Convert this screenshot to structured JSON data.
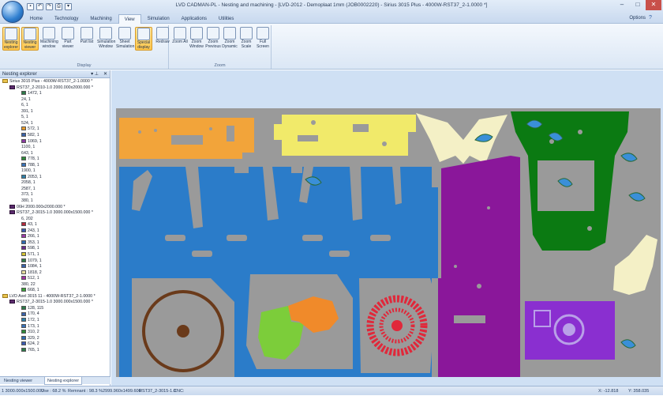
{
  "window": {
    "title": "LVD CADMAN-PL - Nesting and machining - [LVD-2012 - Demoplaat 1mm (JOB0002220) - Sirius 3015 Plus - 4000W-RST37_2-1.0000 *]",
    "qat_icons": [
      "save-icon",
      "undo-icon",
      "redo-icon",
      "print-icon",
      "customize-icon"
    ]
  },
  "ribbon": {
    "tabs": [
      "Home",
      "Technology",
      "Machining",
      "View",
      "Simulation",
      "Applications",
      "Utilities"
    ],
    "active_tab": "View",
    "options_label": "Options",
    "groups": [
      {
        "label": "Display",
        "buttons": [
          {
            "label": "Nesting explorer",
            "icon": "explorer-icon",
            "active": true
          },
          {
            "label": "Nesting viewer",
            "icon": "viewer-icon",
            "active": true
          },
          {
            "label": "Machining window",
            "icon": "machining-icon",
            "active": false
          },
          {
            "label": "Part viewer",
            "icon": "part-viewer-icon",
            "active": false
          },
          {
            "label": "Part list",
            "icon": "part-list-icon",
            "active": false
          },
          {
            "label": "Simulation Window",
            "icon": "simulation-icon",
            "active": false
          },
          {
            "label": "Sheet Simulation",
            "icon": "sheet-sim-icon",
            "active": false
          },
          {
            "label": "Special display",
            "icon": "special-display-icon",
            "active": true
          },
          {
            "label": "Redraw",
            "icon": "redraw-icon",
            "active": false
          }
        ]
      },
      {
        "label": "Zoom",
        "buttons": [
          {
            "label": "Zoom All",
            "icon": "zoom-all-icon",
            "active": false
          },
          {
            "label": "Zoom Window",
            "icon": "zoom-window-icon",
            "active": false
          },
          {
            "label": "Zoom Previous",
            "icon": "zoom-previous-icon",
            "active": false
          },
          {
            "label": "Zoom Dynamic",
            "icon": "zoom-dynamic-icon",
            "active": false
          },
          {
            "label": "Zoom Scale",
            "icon": "zoom-scale-icon",
            "active": false
          },
          {
            "label": "Full Screen",
            "icon": "full-screen-icon",
            "active": false
          }
        ]
      }
    ]
  },
  "explorer": {
    "title": "Nesting explorer",
    "header_icons": [
      "pin-icon",
      "close-icon"
    ],
    "tree": [
      {
        "level": 0,
        "kind": "folder",
        "label": "Sirius 3015 Plus - 4000W-RST37_2-1.0000 *"
      },
      {
        "level": 1,
        "kind": "nest",
        "label": "RST37_2-2010-1.0 2000.000x2000.000 *"
      },
      {
        "level": 2,
        "kind": "part",
        "color": "#2d7a4a",
        "label": "1472, 1"
      },
      {
        "level": 2,
        "kind": "text",
        "label": "24, 1"
      },
      {
        "level": 2,
        "kind": "text",
        "label": "6, 1"
      },
      {
        "level": 2,
        "kind": "text",
        "label": "391, 1"
      },
      {
        "level": 2,
        "kind": "text",
        "label": "5, 1"
      },
      {
        "level": 2,
        "kind": "text",
        "label": "524, 1"
      },
      {
        "level": 2,
        "kind": "part",
        "color": "#e79a2a",
        "label": "572, 1"
      },
      {
        "level": 2,
        "kind": "part",
        "color": "#3a62a8",
        "label": "582, 1"
      },
      {
        "level": 2,
        "kind": "part",
        "color": "#8a3aa0",
        "label": "1069, 1"
      },
      {
        "level": 2,
        "kind": "text",
        "label": "1100, 1"
      },
      {
        "level": 2,
        "kind": "text",
        "label": "643, 1"
      },
      {
        "level": 2,
        "kind": "part",
        "color": "#2f8a3a",
        "label": "778, 1"
      },
      {
        "level": 2,
        "kind": "part",
        "color": "#3a72b8",
        "label": "788, 1"
      },
      {
        "level": 2,
        "kind": "text",
        "label": "1900, 1"
      },
      {
        "level": 2,
        "kind": "part",
        "color": "#2e7fa8",
        "label": "2053, 1"
      },
      {
        "level": 2,
        "kind": "text",
        "label": "2058, 1"
      },
      {
        "level": 2,
        "kind": "text",
        "label": "2587, 1"
      },
      {
        "level": 2,
        "kind": "text",
        "label": "373, 1"
      },
      {
        "level": 2,
        "kind": "text",
        "label": "380, 1"
      },
      {
        "level": 1,
        "kind": "nest",
        "label": "06H 2000.000x2000.000 *"
      },
      {
        "level": 1,
        "kind": "nest",
        "label": "RST37_2-3015-1.0 3000.000x1500.000 *"
      },
      {
        "level": 2,
        "kind": "text",
        "label": "6, 202"
      },
      {
        "level": 2,
        "kind": "part",
        "color": "#b3283a",
        "label": "43, 1"
      },
      {
        "level": 2,
        "kind": "part",
        "color": "#3a5ab0",
        "label": "243, 1"
      },
      {
        "level": 2,
        "kind": "part",
        "color": "#9a3aa8",
        "label": "266, 1"
      },
      {
        "level": 2,
        "kind": "part",
        "color": "#2f6ab0",
        "label": "353, 1"
      },
      {
        "level": 2,
        "kind": "part",
        "color": "#6a2a8a",
        "label": "598, 1"
      },
      {
        "level": 2,
        "kind": "part",
        "color": "#d4c232",
        "label": "571, 1"
      },
      {
        "level": 2,
        "kind": "part",
        "color": "#2f7a4a",
        "label": "1079, 1"
      },
      {
        "level": 2,
        "kind": "part",
        "color": "#3a62a8",
        "label": "1084, 1"
      },
      {
        "level": 2,
        "kind": "part",
        "color": "#e8e0a0",
        "label": "1818, 2"
      },
      {
        "level": 2,
        "kind": "part",
        "color": "#a032a0",
        "label": "512, 1"
      },
      {
        "level": 2,
        "kind": "text",
        "label": "380, 22"
      },
      {
        "level": 2,
        "kind": "part",
        "color": "#3aa03a",
        "label": "668, 1"
      },
      {
        "level": 0,
        "kind": "folder",
        "label": "LVD Axel 3015 11 - 4000W-RST37_2-1.0000 *"
      },
      {
        "level": 1,
        "kind": "nest",
        "label": "RST37_2-3015-1.0 3000.000x1500.000 *"
      },
      {
        "level": 2,
        "kind": "part",
        "color": "#2d7a4a",
        "label": "128, 115"
      },
      {
        "level": 2,
        "kind": "part",
        "color": "#3a62a8",
        "label": "170, 4"
      },
      {
        "level": 2,
        "kind": "part",
        "color": "#2e7fa8",
        "label": "172, 1"
      },
      {
        "level": 2,
        "kind": "part",
        "color": "#3a72b8",
        "label": "173, 1"
      },
      {
        "level": 2,
        "kind": "part",
        "color": "#2f8a3a",
        "label": "310, 2"
      },
      {
        "level": 2,
        "kind": "part",
        "color": "#2f6ab0",
        "label": "329, 2"
      },
      {
        "level": 2,
        "kind": "part",
        "color": "#3a5ab0",
        "label": "624, 2"
      },
      {
        "level": 2,
        "kind": "part",
        "color": "#2d7a4a",
        "label": "765, 1"
      }
    ]
  },
  "bottom_tabs": [
    "Nesting viewer",
    "Nesting explorer"
  ],
  "active_bottom_tab": "Nesting explorer",
  "statusbar": {
    "sheet": "1  3000.000x1500.000",
    "use": "Use : 68.2 %",
    "remnant": "Remnant : 98.3 %",
    "remnant_size": "2999.960x1499.600",
    "material": "RST37_2-3015-1.0",
    "cnc": "CNC:",
    "x": "X: -12.818",
    "y": "Y: 358.035"
  },
  "colors": {
    "sheet_gray": "#9a9a9a",
    "blue_part": "#2b7cc9",
    "orange_part": "#f2a43a",
    "yellow_part": "#f1ea6a",
    "purple_part": "#8a179a",
    "green_part": "#0b7a12",
    "violet_part": "#8a2fd0",
    "red_part": "#e0283a",
    "cream_part": "#f4f0c6",
    "viewer_bg": "#cfe0f4"
  }
}
